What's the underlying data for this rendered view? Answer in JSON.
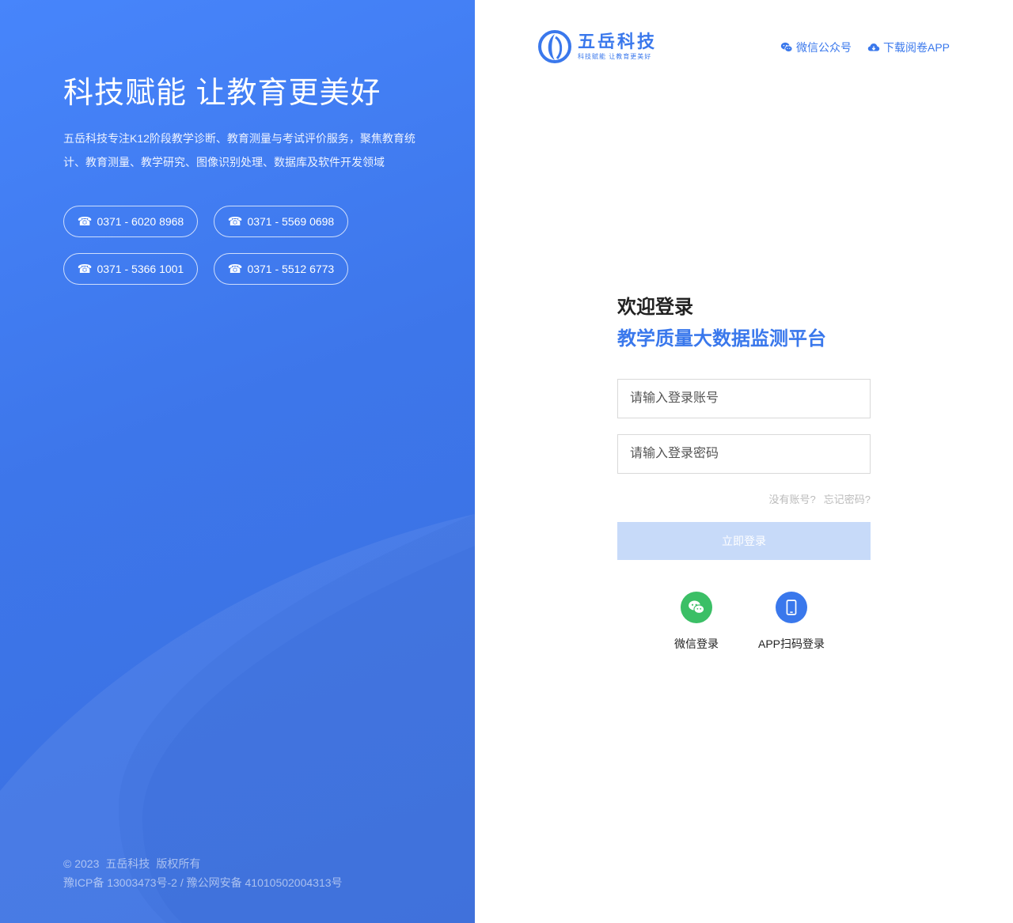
{
  "hero": {
    "slogan": "科技赋能 让教育更美好",
    "intro": "五岳科技专注K12阶段教学诊断、教育测量与考试评价服务，聚焦教育统计、教育测量、教学研究、图像识别处理、数据库及软件开发领域",
    "phones": [
      "0371 - 6020 8968",
      "0371 - 5569 0698",
      "0371 - 5366 1001",
      "0371 - 5512 6773"
    ],
    "phone_icon": "☎"
  },
  "footer": {
    "copyright": "© 2023",
    "company": "五岳科技",
    "rights": "版权所有",
    "icp": "豫ICP备 13003473号-2 / 豫公网安备 41010502004313号"
  },
  "brand": {
    "name": "五岳科技",
    "tagline": "科技赋能 让教育更美好",
    "color": "#3a78ec"
  },
  "topnav": {
    "wechat_official": "微信公众号",
    "download_app": "下载阅卷APP"
  },
  "login": {
    "welcome": "欢迎登录",
    "platform": "教学质量大数据监测平台",
    "account_placeholder": "请输入登录账号",
    "password_placeholder": "请输入登录密码",
    "no_account": "没有账号?",
    "forgot_password": "忘记密码?",
    "submit_label": "立即登录",
    "wechat_login": "微信登录",
    "app_scan_login": "APP扫码登录"
  },
  "colors": {
    "accent": "#3a78ec",
    "wechat_green": "#3bbf66",
    "submit_disabled": "#c7daf9"
  }
}
